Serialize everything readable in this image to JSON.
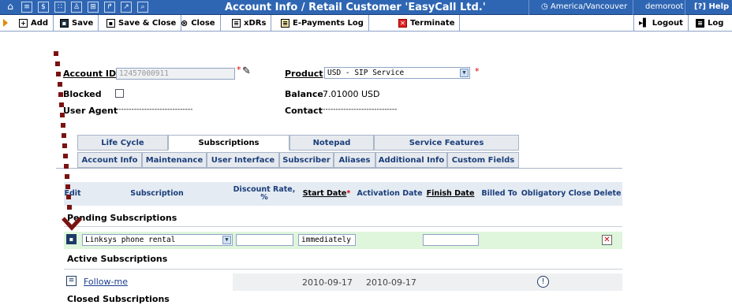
{
  "window": {
    "title": "Account Info / Retail Customer 'EasyCall Ltd.'",
    "timezone": "America/Vancouver",
    "user": "demoroot",
    "help": "Help"
  },
  "toolbar": {
    "add": "Add",
    "save": "Save",
    "save_close": "Save & Close",
    "close": "Close",
    "xdrs": "xDRs",
    "epayments": "E-Payments Log",
    "terminate": "Terminate",
    "logout": "Logout",
    "log": "Log"
  },
  "form": {
    "account_id_label": "Account ID",
    "account_id_value": "12457000911",
    "product_label": "Product",
    "product_value": "USD - SIP Service",
    "blocked_label": "Blocked",
    "blocked_checked": false,
    "balance_label": "Balance",
    "balance_value": "7.01000 USD",
    "user_agent_label": "User Agent",
    "user_agent_value": "------------------------------",
    "contact_label": "Contact",
    "contact_value": "------------------------------"
  },
  "tabs": {
    "row1": [
      "Life Cycle",
      "Subscriptions",
      "Notepad",
      "Service Features"
    ],
    "row2": [
      "Account Info",
      "Maintenance",
      "User Interface",
      "Subscriber",
      "Aliases",
      "Additional Info",
      "Custom Fields"
    ],
    "active": "Subscriptions"
  },
  "table": {
    "headers": [
      "Edit",
      "Subscription",
      "Discount Rate, %",
      "Start Date",
      "Activation Date",
      "Finish Date",
      "Billed To",
      "Obligatory",
      "Close",
      "Delete"
    ]
  },
  "pending": {
    "title": "Pending Subscriptions",
    "subscription": "Linksys phone rental",
    "discount": "",
    "start": "immediately",
    "finish": ""
  },
  "active": {
    "title": "Active Subscriptions",
    "subscription": "Follow-me",
    "start": "2010-09-17",
    "activation": "2010-09-17"
  },
  "closed": {
    "title": "Closed Subscriptions"
  },
  "colors": {
    "topbar": "#2f66b3",
    "pending_row": "#dff5dc",
    "annotation": "#7a1212"
  }
}
